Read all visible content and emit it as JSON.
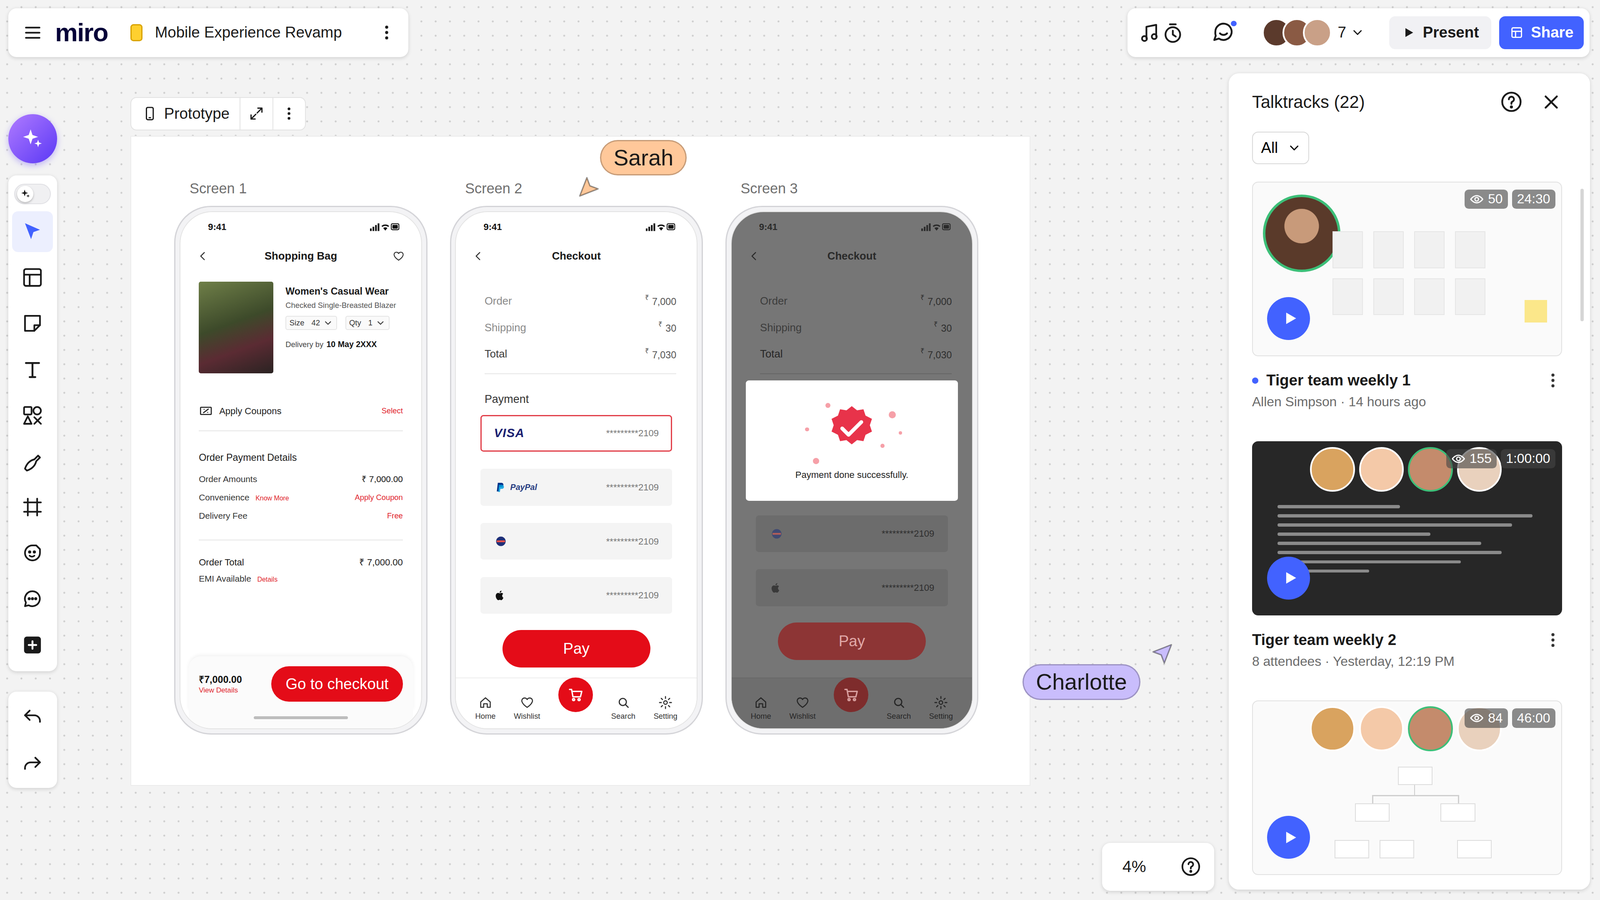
{
  "board": {
    "logo": "miro",
    "title": "Mobile Experience Revamp"
  },
  "topbar": {
    "chat_unread": true,
    "collaborator_count": "7",
    "buttons": [
      {
        "label": "Present",
        "kind": "present"
      },
      {
        "label": "Share",
        "kind": "share"
      }
    ]
  },
  "toolbar": {
    "tools": [
      {
        "selected": false
      },
      {
        "selected": true
      },
      {
        "selected": false
      },
      {
        "selected": false
      },
      {
        "selected": false
      },
      {
        "selected": false
      },
      {
        "selected": false
      },
      {
        "selected": false
      },
      {
        "selected": false
      },
      {
        "selected": false
      },
      {
        "selected": false
      }
    ]
  },
  "frame": {
    "label": "Prototype"
  },
  "screens": [
    {
      "label": "Screen 1",
      "kind": "bag",
      "time": "9:41",
      "title": "Shopping Bag",
      "product": {
        "name": "Women's Casual Wear",
        "desc": "Checked Single-Breasted Blazer",
        "size_label": "Size",
        "size": "42",
        "qty_label": "Qty",
        "qty": "1",
        "delivery_label": "Delivery by",
        "delivery_date": "10 May 2XXX"
      },
      "coupon": {
        "label": "Apply Coupons",
        "action": "Select"
      },
      "details_title": "Order Payment Details",
      "details": [
        {
          "label": "Order Amounts",
          "value": "₹ 7,000.00",
          "kind": "plain"
        },
        {
          "label": "Convenience",
          "link": "Know More",
          "value": "Apply Coupon",
          "kind": "accent"
        },
        {
          "label": "Delivery Fee",
          "value": "Free",
          "kind": "accent"
        }
      ],
      "total": {
        "label": "Order Total",
        "value": "₹ 7,000.00",
        "sub": "EMI Available",
        "sub_link": "Details"
      },
      "footer": {
        "price": "₹7,000.00",
        "link": "View Details",
        "button": "Go to checkout"
      }
    },
    {
      "label": "Screen 2",
      "kind": "checkout",
      "dimmed": false,
      "time": "9:41",
      "title": "Checkout",
      "summary": [
        {
          "label": "Order",
          "currency": "₹",
          "value": "7,000"
        },
        {
          "label": "Shipping",
          "currency": "₹",
          "value": "30"
        },
        {
          "label": "Total",
          "currency": "₹",
          "value": "7,030"
        }
      ],
      "payment_title": "Payment",
      "methods": [
        {
          "kind": "visa",
          "brand": "VISA",
          "number": "*********2109",
          "selected": true
        },
        {
          "kind": "paypal",
          "brand": "PayPal",
          "number": "*********2109",
          "selected": false
        },
        {
          "kind": "card",
          "number": "*********2109",
          "selected": false
        },
        {
          "kind": "apple",
          "number": "*********2109",
          "selected": false
        }
      ],
      "pay": "Pay",
      "nav": [
        {
          "kind": "tab",
          "label": "Home",
          "selected": false
        },
        {
          "kind": "tab",
          "label": "Wishlist",
          "selected": false
        },
        {
          "kind": "cart",
          "selected": true
        },
        {
          "kind": "tab",
          "label": "Search",
          "selected": false
        },
        {
          "kind": "tab",
          "label": "Setting",
          "selected": false
        }
      ]
    },
    {
      "label": "Screen 3",
      "kind": "checkout",
      "dimmed": true,
      "time": "9:41",
      "title": "Checkout",
      "summary": [
        {
          "label": "Order",
          "currency": "₹",
          "value": "7,000"
        },
        {
          "label": "Shipping",
          "currency": "₹",
          "value": "30"
        },
        {
          "label": "Total",
          "currency": "₹",
          "value": "7,030"
        }
      ],
      "modal": {
        "message": "Payment done successfully."
      },
      "methods": [
        {
          "kind": "card",
          "number": "*********2109",
          "selected": false
        },
        {
          "kind": "apple",
          "number": "*********2109",
          "selected": false
        }
      ],
      "pay": "Pay",
      "nav": [
        {
          "kind": "tab",
          "label": "Home",
          "selected": false
        },
        {
          "kind": "tab",
          "label": "Wishlist",
          "selected": false
        },
        {
          "kind": "cart",
          "selected": true
        },
        {
          "kind": "tab",
          "label": "Search",
          "selected": false
        },
        {
          "kind": "tab",
          "label": "Setting",
          "selected": false
        }
      ]
    }
  ],
  "cursors": [
    {
      "name": "Sarah",
      "color": "#ffc89a"
    },
    {
      "name": "Charlotte",
      "color": "#c9bdfc"
    }
  ],
  "talktracks": {
    "title": "Talktracks (22)",
    "filter": "All",
    "items": [
      {
        "kind": "solo",
        "title": "Tiger team weekly 1",
        "meta": "Allen Simpson · 14 hours ago",
        "views": "50",
        "duration": "24:30",
        "unread": true
      },
      {
        "kind": "panel",
        "title": "Tiger team weekly 2",
        "meta": "8 attendees · Yesterday, 12:19 PM",
        "views": "155",
        "duration": "1:00:00",
        "unread": false
      },
      {
        "kind": "board",
        "views": "84",
        "duration": "46:00"
      }
    ]
  },
  "zoom": {
    "level": "4%"
  }
}
